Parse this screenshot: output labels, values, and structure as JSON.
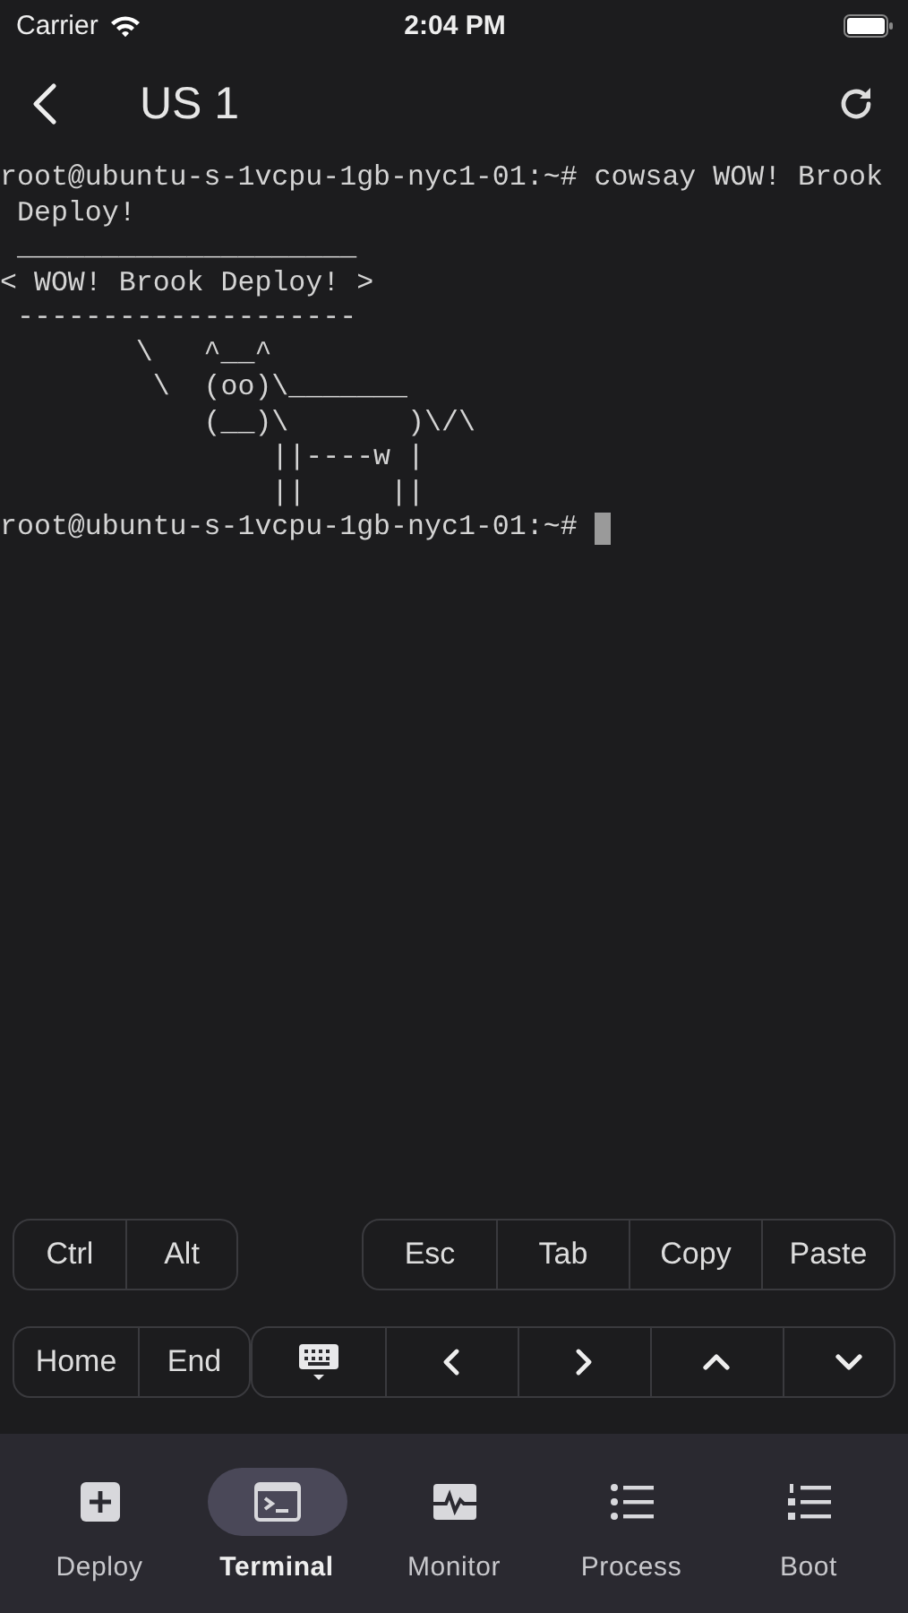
{
  "status_bar": {
    "carrier": "Carrier",
    "time": "2:04 PM"
  },
  "nav": {
    "title": "US 1"
  },
  "terminal": {
    "lines": [
      "root@ubuntu-s-1vcpu-1gb-nyc1-01:~# cowsay WOW! Brook",
      " Deploy!",
      " ____________________",
      "< WOW! Brook Deploy! >",
      " --------------------",
      "        \\   ^__^",
      "         \\  (oo)\\_______",
      "            (__)\\       )\\/\\",
      "                ||----w |",
      "                ||     ||"
    ],
    "prompt": "root@ubuntu-s-1vcpu-1gb-nyc1-01:~# "
  },
  "key_rows": [
    [
      {
        "keys": [
          {
            "kind": "text",
            "label": "Ctrl"
          },
          {
            "kind": "text",
            "label": "Alt"
          }
        ]
      },
      {
        "keys": [
          {
            "kind": "text",
            "label": "Esc"
          },
          {
            "kind": "text",
            "label": "Tab"
          },
          {
            "kind": "text",
            "label": "Copy"
          },
          {
            "kind": "text",
            "label": "Paste"
          }
        ]
      }
    ],
    [
      {
        "keys": [
          {
            "kind": "text",
            "label": "Home"
          },
          {
            "kind": "text",
            "label": "End"
          }
        ]
      },
      {
        "keys": [
          {
            "kind": "keyboard"
          },
          {
            "kind": "left"
          },
          {
            "kind": "right"
          },
          {
            "kind": "up"
          },
          {
            "kind": "down"
          }
        ]
      }
    ]
  ],
  "tabs": [
    {
      "label": "Deploy",
      "kind": "plus",
      "selected": false
    },
    {
      "label": "Terminal",
      "kind": "terminal",
      "selected": true
    },
    {
      "label": "Monitor",
      "kind": "pulse",
      "selected": false
    },
    {
      "label": "Process",
      "kind": "list",
      "selected": false
    },
    {
      "label": "Boot",
      "kind": "numbered",
      "selected": false
    }
  ]
}
